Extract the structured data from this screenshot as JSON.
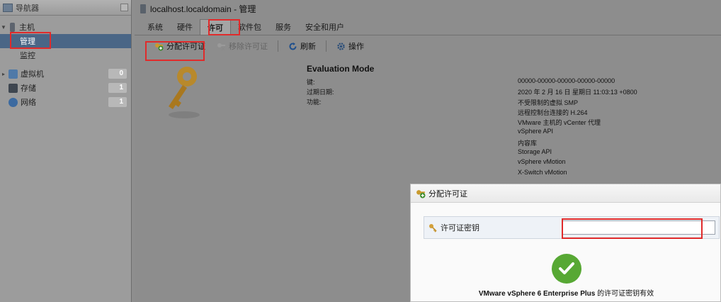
{
  "navigator": {
    "title": "导航器",
    "items": [
      {
        "label": "主机",
        "badge": ""
      },
      {
        "label": "管理",
        "badge": ""
      },
      {
        "label": "监控",
        "badge": ""
      },
      {
        "label": "虚拟机",
        "badge": "0"
      },
      {
        "label": "存储",
        "badge": "1"
      },
      {
        "label": "网络",
        "badge": "1"
      }
    ]
  },
  "main": {
    "title": "localhost.localdomain - 管理",
    "tabs": [
      "系统",
      "硬件",
      "许可",
      "软件包",
      "服务",
      "安全和用户"
    ],
    "active_tab": "许可",
    "toolbar": {
      "assign_license": "分配许可证",
      "remove_license": "移除许可证",
      "refresh": "刷新",
      "actions": "操作"
    },
    "license": {
      "mode": "Evaluation Mode",
      "labels": {
        "key": "键:",
        "expiry": "过期日期:",
        "features": "功能:"
      },
      "key": "00000-00000-00000-00000-00000",
      "expiry": "2020 年 2 月 16 日 星期日 11:03:13 +0800",
      "features": [
        "不受限制的虚拟 SMP",
        "远程控制台连接的 H.264",
        "VMware 主机的 vCenter 代理",
        "vSphere API",
        "内容库",
        "Storage API",
        "vSphere vMotion",
        "X-Switch vMotion"
      ]
    }
  },
  "dialog": {
    "title": "分配许可证",
    "field_label": "许可证密钥",
    "input_value": "",
    "message_product": "VMware vSphere 6 Enterprise Plus",
    "message_suffix": " 的许可证密钥有效"
  },
  "colors": {
    "highlight": "#e02b2b",
    "selected": "#4a6686",
    "success": "#57a834"
  },
  "icons": [
    "host-icon",
    "vm-icon",
    "storage-icon",
    "network-icon",
    "key-icon",
    "refresh-icon",
    "gear-icon",
    "checkmark-icon"
  ]
}
